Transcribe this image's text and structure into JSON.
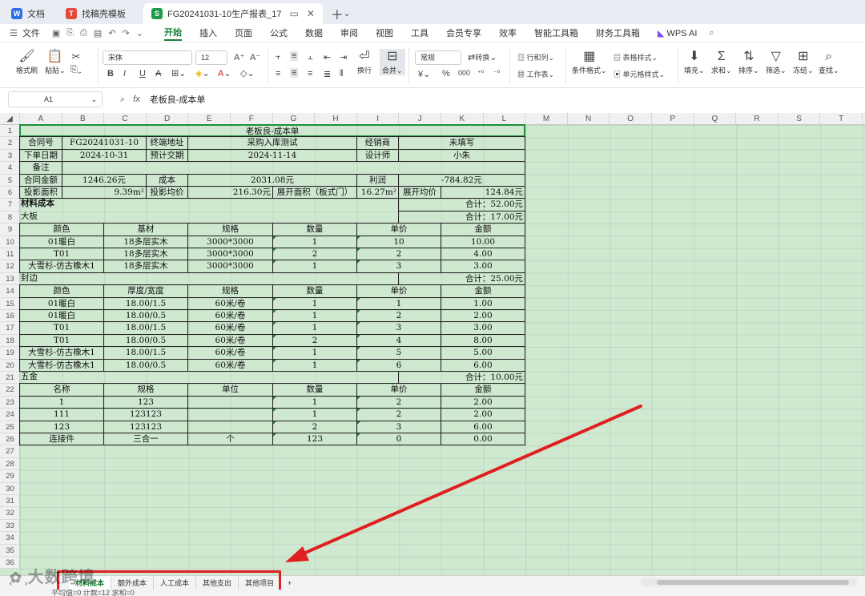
{
  "tabs": [
    {
      "label": "文档",
      "icon": "doc-icon",
      "color": "#2f6fe4"
    },
    {
      "label": "找稿壳模板",
      "icon": "template-icon",
      "color": "#e24a3b"
    },
    {
      "label": "FG20241031-10生产报表_17",
      "icon": "sheet-icon",
      "color": "#1f9a4a",
      "active": true
    }
  ],
  "menu": {
    "file": "文件",
    "items": [
      "开始",
      "插入",
      "页面",
      "公式",
      "数据",
      "审阅",
      "视图",
      "工具",
      "会员专享",
      "效率",
      "智能工具箱",
      "财务工具箱"
    ],
    "active": "开始",
    "ai": "WPS AI"
  },
  "ribbon": {
    "format_painter": "格式刷",
    "paste": "粘贴",
    "font": "宋体",
    "size": "12",
    "wrap": "换行",
    "merge": "合并",
    "numfmt": "常规",
    "convert": "转换",
    "rowcol": "行和列",
    "worksheet": "工作表",
    "condfmt": "条件格式",
    "tablestyle": "表格样式",
    "cellstyle": "单元格样式",
    "fill": "填充",
    "sum": "求和",
    "sort": "排序",
    "filter": "筛选",
    "freeze": "冻结",
    "find": "查找"
  },
  "formula": {
    "cell": "A1",
    "content": "老板良-成本单"
  },
  "columns": [
    "A",
    "B",
    "C",
    "D",
    "E",
    "F",
    "G",
    "H",
    "I",
    "J",
    "K",
    "L",
    "M",
    "N",
    "O",
    "P",
    "Q",
    "R",
    "S",
    "T"
  ],
  "rows": [
    "1",
    "2",
    "3",
    "4",
    "5",
    "6",
    "7",
    "8",
    "9",
    "10",
    "11",
    "12",
    "13",
    "14",
    "15",
    "16",
    "17",
    "18",
    "19",
    "20",
    "21",
    "22",
    "23",
    "24",
    "25",
    "26",
    "27",
    "28",
    "29",
    "30",
    "31",
    "32",
    "33",
    "34",
    "35",
    "36"
  ],
  "sheet": {
    "title": "老板良-成本单",
    "r2": [
      "合同号",
      "FG20241031-10",
      "终端地址",
      "采购入库测试",
      "经销商",
      "未填写"
    ],
    "r3": [
      "下单日期",
      "2024-10-31",
      "预计交期",
      "2024-11-14",
      "设计师",
      "小朱"
    ],
    "r4": [
      "备注",
      ""
    ],
    "r5": [
      "合同金额",
      "1246.26元",
      "成本",
      "2031.08元",
      "利润",
      "-784.82元"
    ],
    "r6": [
      "投影面积",
      "9.39m²",
      "投影均价",
      "216.30元",
      "展开面积（板式门）",
      "16.27m²",
      "展开均价",
      "124.84元"
    ],
    "material": {
      "label": "材料成本",
      "total": "合计：52.00元"
    },
    "board": {
      "label": "大板",
      "total": "合计：17.00元",
      "headers": [
        "颜色",
        "基材",
        "规格",
        "数量",
        "单价",
        "金额"
      ],
      "rows": [
        [
          "01暖白",
          "18多层实木",
          "3000*3000",
          "1",
          "10",
          "10.00"
        ],
        [
          "T01",
          "18多层实木",
          "3000*3000",
          "2",
          "2",
          "4.00"
        ],
        [
          "大雪杉-仿古橡木1",
          "18多层实木",
          "3000*3000",
          "1",
          "3",
          "3.00"
        ]
      ]
    },
    "edge": {
      "label": "封边",
      "total": "合计：25.00元",
      "headers": [
        "颜色",
        "厚度/宽度",
        "规格",
        "数量",
        "单价",
        "金额"
      ],
      "rows": [
        [
          "01暖白",
          "18.00/1.5",
          "60米/卷",
          "1",
          "1",
          "1.00"
        ],
        [
          "01暖白",
          "18.00/0.5",
          "60米/卷",
          "1",
          "2",
          "2.00"
        ],
        [
          "T01",
          "18.00/1.5",
          "60米/卷",
          "1",
          "3",
          "3.00"
        ],
        [
          "T01",
          "18.00/0.5",
          "60米/卷",
          "2",
          "4",
          "8.00"
        ],
        [
          "大雪杉-仿古橡木1",
          "18.00/1.5",
          "60米/卷",
          "1",
          "5",
          "5.00"
        ],
        [
          "大雪杉-仿古橡木1",
          "18.00/0.5",
          "60米/卷",
          "1",
          "6",
          "6.00"
        ]
      ]
    },
    "hardware": {
      "label": "五金",
      "total": "合计：10.00元",
      "headers": [
        "名称",
        "规格",
        "单位",
        "数量",
        "单价",
        "金额"
      ],
      "rows": [
        [
          "1",
          "123",
          "",
          "1",
          "2",
          "2.00"
        ],
        [
          "111",
          "123123",
          "",
          "1",
          "2",
          "2.00"
        ],
        [
          "123",
          "123123",
          "",
          "2",
          "3",
          "6.00"
        ],
        [
          "连接件",
          "三合一",
          "个",
          "123",
          "0",
          "0.00"
        ]
      ]
    }
  },
  "sheet_tabs": [
    "材料成本",
    "额外成本",
    "人工成本",
    "其他支出",
    "其他项目"
  ],
  "watermark": "大数跨境",
  "status": "平均值=0  计数=12  求和=0",
  "colors": {
    "accent": "#1a7f37",
    "sheet_bg": "#cfe8d0",
    "annotation": "#e02020"
  }
}
